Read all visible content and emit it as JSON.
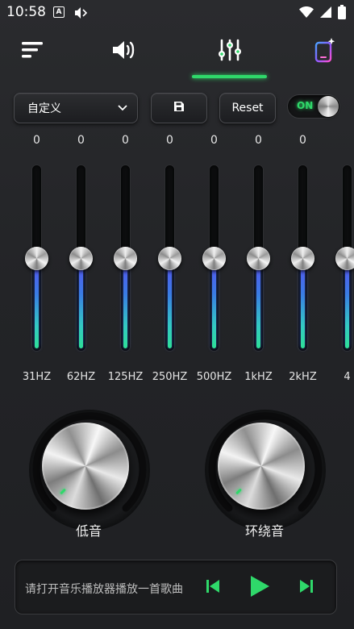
{
  "status_bar": {
    "time": "10:58",
    "badge_letter": "A",
    "icons": [
      "a-badge-icon",
      "cast-icon",
      "wifi-icon",
      "signal-icon",
      "battery-icon"
    ]
  },
  "nav": {
    "tabs": [
      "menu-icon",
      "volume-icon",
      "equalizer-sliders-icon",
      "theme-phone-icon"
    ],
    "active_tab": "equalizer",
    "accent_color": "#2fd86a"
  },
  "controls": {
    "preset_value": "自定义",
    "save_icon": "save-icon",
    "reset_label": "Reset",
    "toggle_label": "ON",
    "toggle_state": true
  },
  "eq": {
    "bands": [
      {
        "label": "31HZ",
        "value": "0",
        "level": 0.5
      },
      {
        "label": "62HZ",
        "value": "0",
        "level": 0.5
      },
      {
        "label": "125HZ",
        "value": "0",
        "level": 0.5
      },
      {
        "label": "250HZ",
        "value": "0",
        "level": 0.5
      },
      {
        "label": "500HZ",
        "value": "0",
        "level": 0.5
      },
      {
        "label": "1kHZ",
        "value": "0",
        "level": 0.5
      },
      {
        "label": "2kHZ",
        "value": "0",
        "level": 0.5
      },
      {
        "label": "4",
        "value": "",
        "level": 0.5
      }
    ]
  },
  "knobs": {
    "bass_label": "低音",
    "surround_label": "环绕音"
  },
  "player": {
    "message": "请打开音乐播放器播放一首歌曲",
    "button_color": "#2fd86a"
  }
}
